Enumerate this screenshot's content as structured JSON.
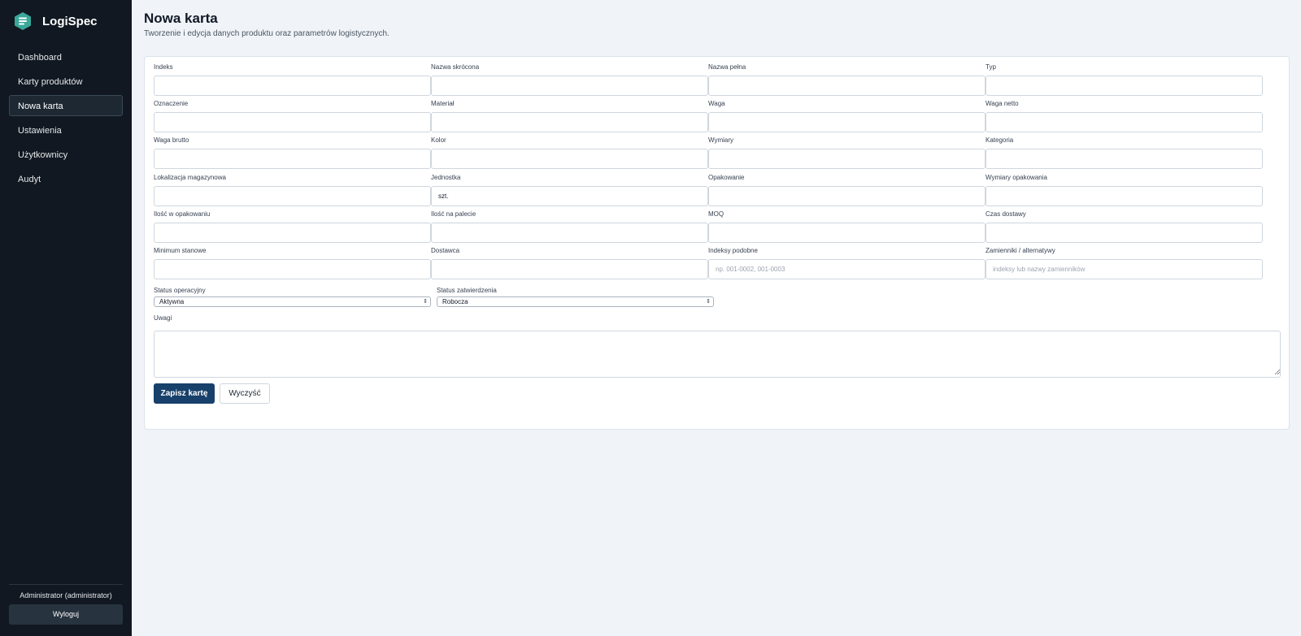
{
  "app": {
    "name": "LogiSpec"
  },
  "nav": {
    "items": [
      {
        "label": "Dashboard"
      },
      {
        "label": "Karty produktów"
      },
      {
        "label": "Nowa karta",
        "active": true
      },
      {
        "label": "Ustawienia"
      },
      {
        "label": "Użytkownicy"
      },
      {
        "label": "Audyt"
      }
    ]
  },
  "user": {
    "label": "Administrator (administrator)",
    "logout_label": "Wyloguj"
  },
  "page": {
    "title": "Nowa karta",
    "subtitle": "Tworzenie i edycja danych produktu oraz parametrów logistycznych."
  },
  "form": {
    "fields": [
      {
        "label": "Indeks",
        "value": "",
        "placeholder": ""
      },
      {
        "label": "Nazwa skrócona",
        "value": "",
        "placeholder": ""
      },
      {
        "label": "Nazwa pełna",
        "value": "",
        "placeholder": ""
      },
      {
        "label": "Typ",
        "value": "",
        "placeholder": ""
      },
      {
        "label": "Oznaczenie",
        "value": "",
        "placeholder": ""
      },
      {
        "label": "Materiał",
        "value": "",
        "placeholder": ""
      },
      {
        "label": "Waga",
        "value": "",
        "placeholder": ""
      },
      {
        "label": "Waga netto",
        "value": "",
        "placeholder": ""
      },
      {
        "label": "Waga brutto",
        "value": "",
        "placeholder": ""
      },
      {
        "label": "Kolor",
        "value": "",
        "placeholder": ""
      },
      {
        "label": "Wymiary",
        "value": "",
        "placeholder": ""
      },
      {
        "label": "Kategoria",
        "value": "",
        "placeholder": ""
      },
      {
        "label": "Lokalizacja magazynowa",
        "value": "",
        "placeholder": ""
      },
      {
        "label": "Jednostka",
        "value": "szt.",
        "placeholder": ""
      },
      {
        "label": "Opakowanie",
        "value": "",
        "placeholder": ""
      },
      {
        "label": "Wymiary opakowania",
        "value": "",
        "placeholder": ""
      },
      {
        "label": "Ilość w opakowaniu",
        "value": "",
        "placeholder": ""
      },
      {
        "label": "Ilość na palecie",
        "value": "",
        "placeholder": ""
      },
      {
        "label": "MOQ",
        "value": "",
        "placeholder": ""
      },
      {
        "label": "Czas dostawy",
        "value": "",
        "placeholder": ""
      },
      {
        "label": "Minimum stanowe",
        "value": "",
        "placeholder": ""
      },
      {
        "label": "Dostawca",
        "value": "",
        "placeholder": ""
      },
      {
        "label": "Indeksy podobne",
        "value": "",
        "placeholder": "np. 001-0002, 001-0003"
      },
      {
        "label": "Zamienniki / alternatywy",
        "value": "",
        "placeholder": "indeksy lub nazwy zamienników"
      }
    ],
    "status_operacyjny": {
      "label": "Status operacyjny",
      "value": "Aktywna"
    },
    "status_zatwierdzenia": {
      "label": "Status zatwierdzenia",
      "value": "Robocza"
    },
    "uwagi": {
      "label": "Uwagi",
      "value": ""
    },
    "save_label": "Zapisz kartę",
    "clear_label": "Wyczyść"
  },
  "colors": {
    "sidebar_bg": "#111821",
    "page_bg": "#f0f4f8",
    "primary": "#17406a",
    "logo": "#3aa79a"
  }
}
